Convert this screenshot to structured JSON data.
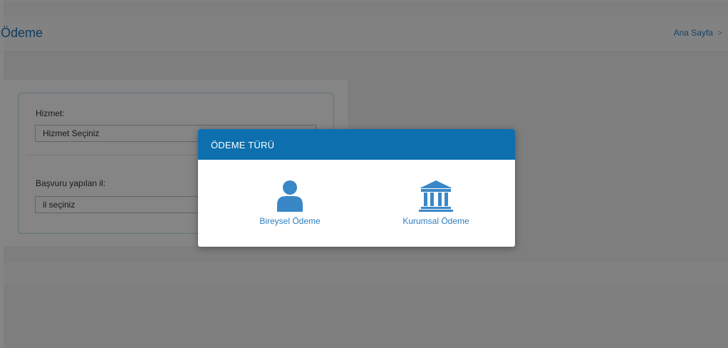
{
  "header": {
    "title": "Ödeme",
    "breadcrumb": "Ana Sayfa",
    "breadcrumb_chevron": ">"
  },
  "form": {
    "service_label": "Hizmet:",
    "service_value": "Hizmet Seçiniz",
    "province_label": "Başvuru yapılan il:",
    "province_value": "il seçiniz"
  },
  "modal": {
    "title": "ÖDEME TÜRÜ",
    "options": [
      {
        "label": "Bireysel Ödeme",
        "icon": "user-icon"
      },
      {
        "label": "Kurumsal Ödeme",
        "icon": "institution-icon"
      }
    ]
  },
  "colors": {
    "accent": "#0d6fad",
    "icon": "#3a87c8",
    "link": "#2d7fc1"
  }
}
